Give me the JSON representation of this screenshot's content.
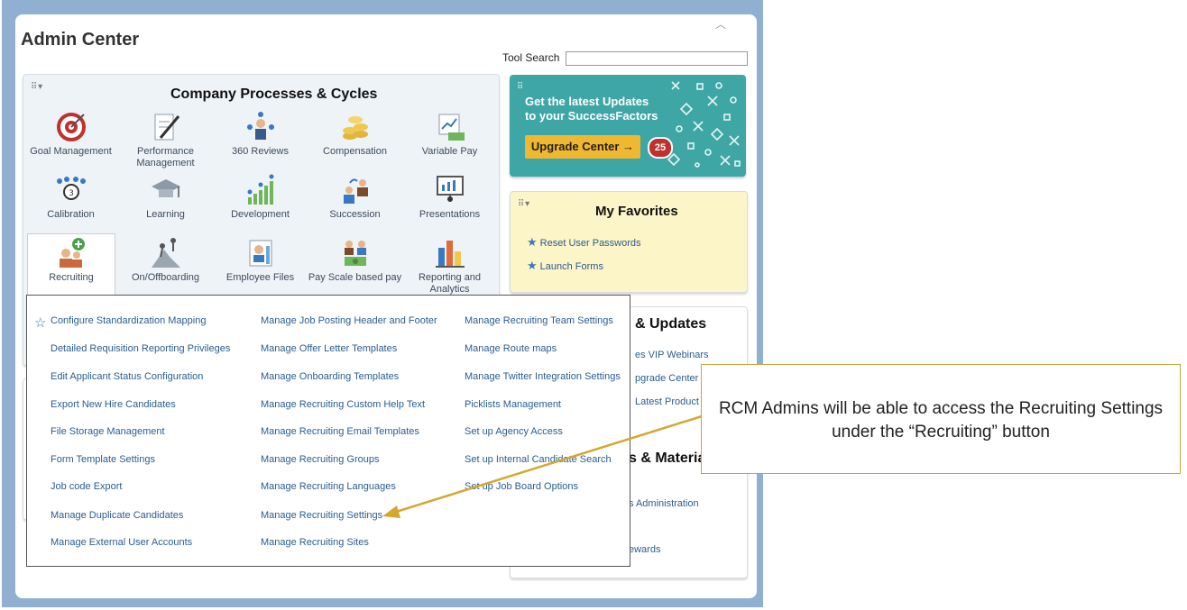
{
  "header": {
    "title": "Admin Center",
    "tool_search_label": "Tool Search",
    "tool_search_value": ""
  },
  "processes": {
    "title": "Company Processes & Cycles",
    "tiles": [
      {
        "label": "Goal Management"
      },
      {
        "label": "Performance Management"
      },
      {
        "label": "360 Reviews"
      },
      {
        "label": "Compensation"
      },
      {
        "label": "Variable Pay"
      },
      {
        "label": "Calibration"
      },
      {
        "label": "Learning"
      },
      {
        "label": "Development"
      },
      {
        "label": "Succession"
      },
      {
        "label": "Presentations"
      },
      {
        "label": "Recruiting"
      },
      {
        "label": "On/Offboarding"
      },
      {
        "label": "Employee Files"
      },
      {
        "label": "Pay Scale based pay"
      },
      {
        "label": "Reporting and Analytics"
      }
    ]
  },
  "updates": {
    "line1": "Get the latest Updates",
    "line2": "to your SuccessFactors",
    "button_label": "Upgrade Center →",
    "badge_count": "25"
  },
  "favorites": {
    "title": "My Favorites",
    "items": [
      "Reset User Passwords",
      "Launch Forms"
    ]
  },
  "background": {
    "updates_head": "& Updates",
    "updates_links": [
      "es VIP Webinars",
      "pgrade Center",
      "Latest Product U"
    ],
    "materials_head": "s & Materia",
    "materials_links": [
      "s Administration",
      "ewards"
    ]
  },
  "recruiting_menu": {
    "col1": [
      "Configure Standardization Mapping",
      "Detailed Requisition Reporting Privileges",
      "Edit Applicant Status Configuration",
      "Export New Hire Candidates",
      "File Storage Management",
      "Form Template Settings",
      "Job code Export",
      "Manage Duplicate Candidates",
      "Manage External User Accounts"
    ],
    "col2": [
      "Manage Job Posting Header and Footer",
      "Manage Offer Letter Templates",
      "Manage Onboarding Templates",
      "Manage Recruiting Custom Help Text",
      "Manage Recruiting Email Templates",
      "Manage Recruiting Groups",
      "Manage Recruiting Languages",
      "Manage Recruiting Settings",
      "Manage Recruiting Sites"
    ],
    "col3": [
      "Manage Recruiting Team Settings",
      "Manage Route maps",
      "Manage Twitter Integration Settings",
      "Picklists Management",
      "Set up Agency Access",
      "Set up Internal Candidate Search",
      "Set up Job Board Options"
    ]
  },
  "callout": {
    "text": "RCM Admins will be able to access the Recruiting Settings under the “Recruiting” button"
  },
  "colors": {
    "frame": "#8fb0d1",
    "teal": "#3ea7a6",
    "upgrade_button": "#f0b830",
    "badge": "#c0302c",
    "favorites_bg": "#fbf5c8",
    "link": "#2a5d8f",
    "callout_border": "#c9a43a"
  }
}
